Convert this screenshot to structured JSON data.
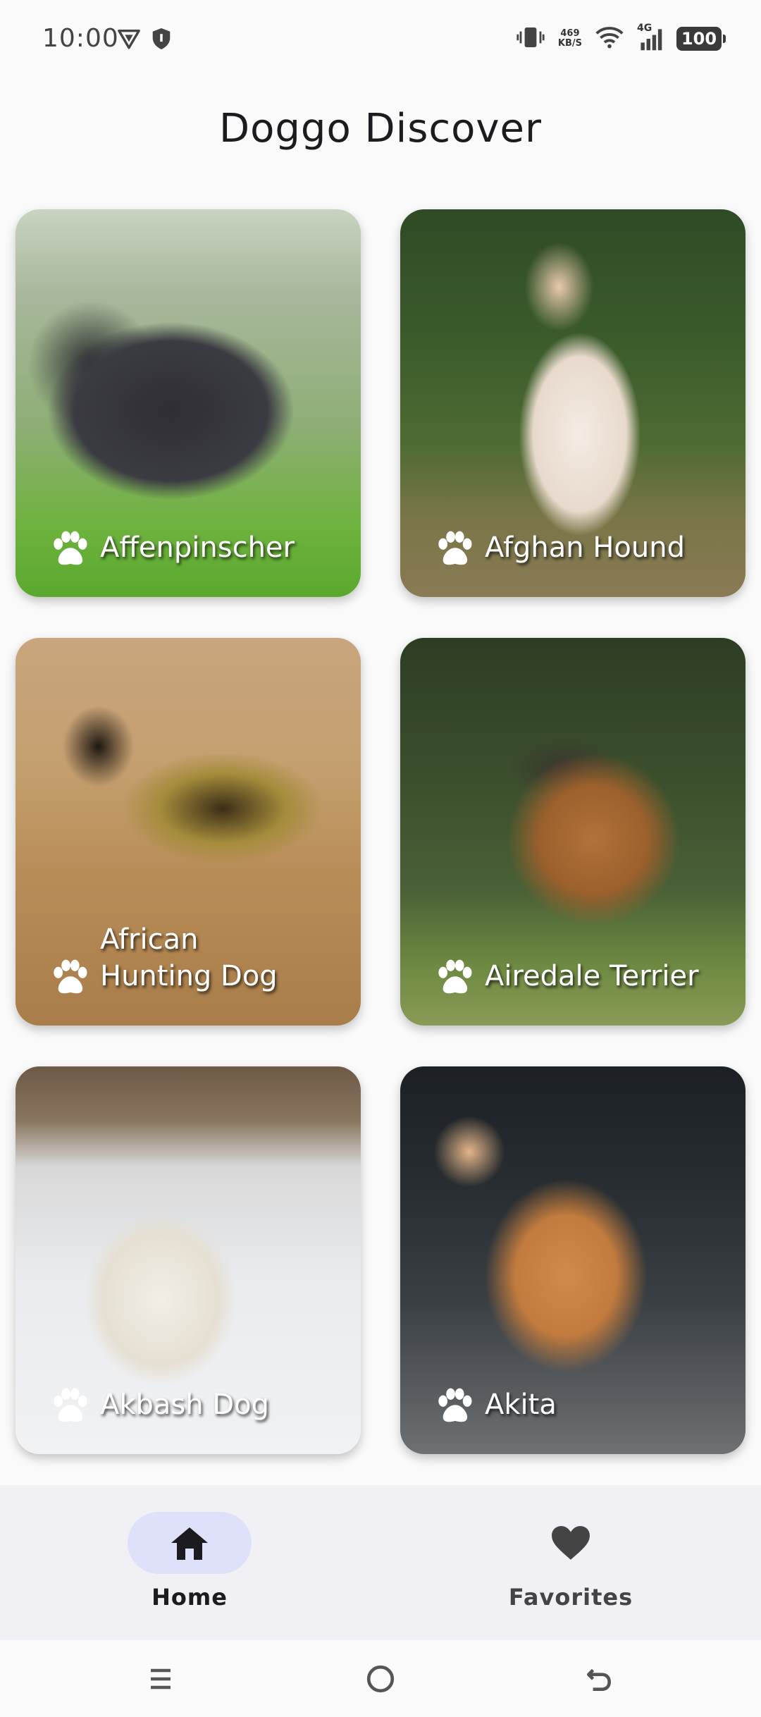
{
  "status_bar": {
    "time": "10:00",
    "net_speed_value": "469",
    "net_speed_unit": "KB/S",
    "network_type": "4G",
    "battery": "100"
  },
  "app": {
    "title": "Doggo Discover"
  },
  "breeds": [
    {
      "name": "Affenpinscher"
    },
    {
      "name": "Afghan Hound"
    },
    {
      "name": "African Hunting Dog"
    },
    {
      "name": "Airedale Terrier"
    },
    {
      "name": "Akbash Dog"
    },
    {
      "name": "Akita"
    }
  ],
  "bottom_nav": {
    "items": [
      {
        "label": "Home",
        "icon": "home-icon",
        "selected": true
      },
      {
        "label": "Favorites",
        "icon": "heart-icon",
        "selected": false
      }
    ],
    "indicator_color": "#dfe1fa"
  },
  "colors": {
    "background": "#fafafa",
    "nav_background": "#f1f0f4",
    "icon_dark": "#1c1b1f"
  }
}
